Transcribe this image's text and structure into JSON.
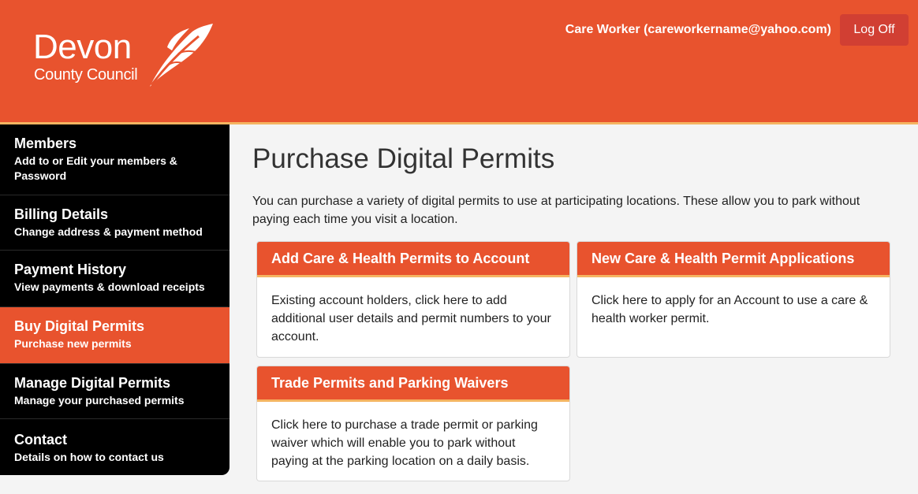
{
  "header": {
    "logo": {
      "title": "Devon",
      "subtitle": "County Council"
    },
    "user_label": "Care Worker (careworkername@yahoo.com)",
    "logoff_label": "Log Off",
    "colors": {
      "brand": "#e8532e",
      "stripe": "#f5b461",
      "logoff": "#d13f33"
    }
  },
  "sidebar": {
    "items": [
      {
        "title": "Members",
        "subtitle": "Add to or Edit your members & Password",
        "active": false
      },
      {
        "title": "Billing Details",
        "subtitle": "Change address & payment method",
        "active": false
      },
      {
        "title": "Payment History",
        "subtitle": "View payments & download receipts",
        "active": false
      },
      {
        "title": "Buy Digital Permits",
        "subtitle": "Purchase new permits",
        "active": true
      },
      {
        "title": "Manage Digital Permits",
        "subtitle": "Manage your purchased permits",
        "active": false
      },
      {
        "title": "Contact",
        "subtitle": "Details on how to contact us",
        "active": false
      }
    ]
  },
  "main": {
    "title": "Purchase Digital Permits",
    "intro": "You can purchase a variety of digital permits to use at participating locations. These allow you to park without paying each time you visit a location.",
    "cards": [
      {
        "title": "Add Care & Health Permits to Account",
        "body": "Existing account holders, click here to add additional user details and permit numbers to your account."
      },
      {
        "title": "New Care & Health Permit Applications",
        "body": "Click here to apply for an Account to use a care & health worker permit."
      },
      {
        "title": "Trade Permits and Parking Waivers",
        "body": "Click here to purchase a trade permit or parking waiver which will enable you to park without paying at the parking location on a daily basis."
      }
    ]
  }
}
